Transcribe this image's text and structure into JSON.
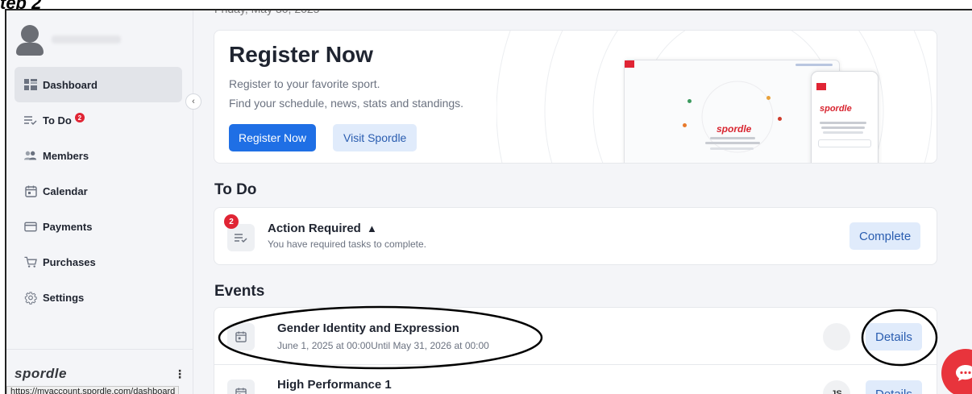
{
  "step_label": "tep 2",
  "date_strip": "Friday, May 30, 2025",
  "sidebar": {
    "nav": [
      {
        "label": "Dashboard",
        "icon": "grid-icon",
        "active": true
      },
      {
        "label": "To Do",
        "icon": "checklist-icon",
        "badge": "2"
      },
      {
        "label": "Members",
        "icon": "users-icon"
      },
      {
        "label": "Calendar",
        "icon": "calendar-icon"
      },
      {
        "label": "Payments",
        "icon": "credit-card-icon"
      },
      {
        "label": "Purchases",
        "icon": "cart-icon"
      },
      {
        "label": "Settings",
        "icon": "gear-icon"
      }
    ],
    "collapse_glyph": "‹",
    "brand": "spordle",
    "kebab": "⋮"
  },
  "status_url": "https://myaccount.spordle.com/dashboard",
  "hero": {
    "title": "Register Now",
    "line1": "Register to your favorite sport.",
    "line2": "Find your schedule, news, stats and standings.",
    "primary_button": "Register Now",
    "secondary_button": "Visit Spordle",
    "mockup_word": "spordle"
  },
  "todo": {
    "section_title": "To Do",
    "badge": "2",
    "title": "Action Required",
    "warning_glyph": "▲",
    "subtitle": "You have required tasks to complete.",
    "button": "Complete"
  },
  "events": {
    "section_title": "Events",
    "items": [
      {
        "title": "Gender Identity and Expression",
        "date": "June 1, 2025 at 00:00Until May 31, 2026 at 00:00",
        "avatar": "",
        "button": "Details"
      },
      {
        "title": "High Performance 1",
        "date": "",
        "avatar": "JS",
        "button": "Details"
      }
    ]
  },
  "colors": {
    "primary": "#1f6fe5",
    "brand_red": "#e02434",
    "light_button": "#e0ebfb"
  }
}
